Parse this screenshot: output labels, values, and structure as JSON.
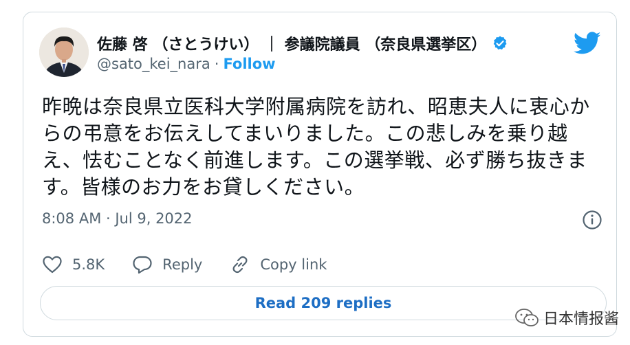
{
  "tweet": {
    "display_name": "佐藤 啓 （さとうけい） ｜ 参議院議員 （奈良県選挙区）",
    "handle": "@sato_kei_nara",
    "separator": "·",
    "follow_label": "Follow",
    "text": "昨晩は奈良県立医科大学附属病院を訪れ、昭恵夫人に衷心からの弔意をお伝えしてまいりました。この悲しみを乗り越え、怯むことなく前進します。この選挙戦、必ず勝ち抜きます。皆様のお力をお貸しください。",
    "timestamp": "8:08 AM · Jul 9, 2022",
    "likes": "5.8K",
    "reply_label": "Reply",
    "copy_link_label": "Copy link",
    "read_replies_label": "Read 209 replies"
  },
  "watermark": {
    "label": "日本情报酱"
  },
  "icons": {
    "verified": "verified-badge-icon",
    "bird": "twitter-bird-icon",
    "info": "info-icon",
    "like": "heart-icon",
    "reply": "speech-bubble-icon",
    "copy_link": "link-icon",
    "watermark": "wechat-icon"
  },
  "colors": {
    "brand": "#1d9bf0",
    "secondary_text": "#536471",
    "border": "#cfd9de"
  }
}
